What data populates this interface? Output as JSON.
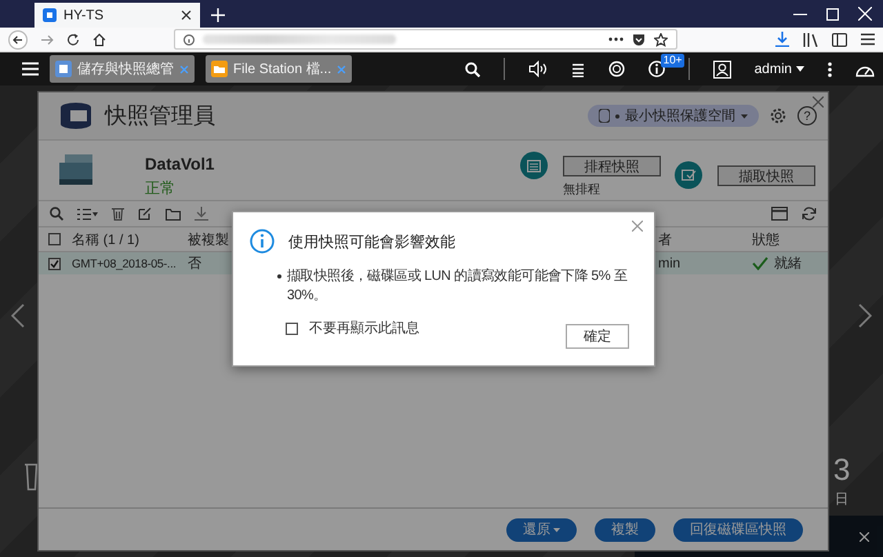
{
  "browser": {
    "tab_title": "HY-TS"
  },
  "qts_bar": {
    "app_tabs": [
      {
        "label": "儲存與快照總管",
        "kind": "storage"
      },
      {
        "label": "File Station 檔...",
        "kind": "folder"
      }
    ],
    "notification_badge": "10+",
    "user": "admin"
  },
  "desktop": {
    "clock_digit": "3",
    "clock_weekday": "日"
  },
  "window": {
    "title": "快照管理員",
    "space_button": "最小快照保護空間",
    "help": "?",
    "volume": {
      "name": "DataVol1",
      "status": "正常"
    },
    "actions": [
      {
        "label": "排程快照",
        "kind": "schedule",
        "note": "無排程"
      },
      {
        "label": "擷取快照",
        "kind": "capture"
      }
    ],
    "table": {
      "header_checked": false,
      "columns": [
        "名稱 (1 / 1)",
        "被複製",
        "者",
        "狀態"
      ],
      "rows": [
        {
          "checked": true,
          "selected": true,
          "ready": true,
          "cells": [
            "GMT+08_2018-05-...",
            "否",
            "min",
            "就緒"
          ]
        }
      ]
    },
    "footer_buttons": [
      {
        "label": "還原",
        "kind": "dropdown"
      },
      {
        "label": "複製",
        "kind": "plain"
      },
      {
        "label": "回復磁碟區快照",
        "kind": "plain"
      }
    ]
  },
  "dialog": {
    "title": "使用快照可能會影響效能",
    "bullets": [
      "擷取快照後，磁碟區或 LUN 的讀寫效能可能會下降 5% 至 30%。"
    ],
    "checkbox": {
      "label": "不要再顯示此訊息",
      "checked": false
    },
    "button": "確定"
  }
}
